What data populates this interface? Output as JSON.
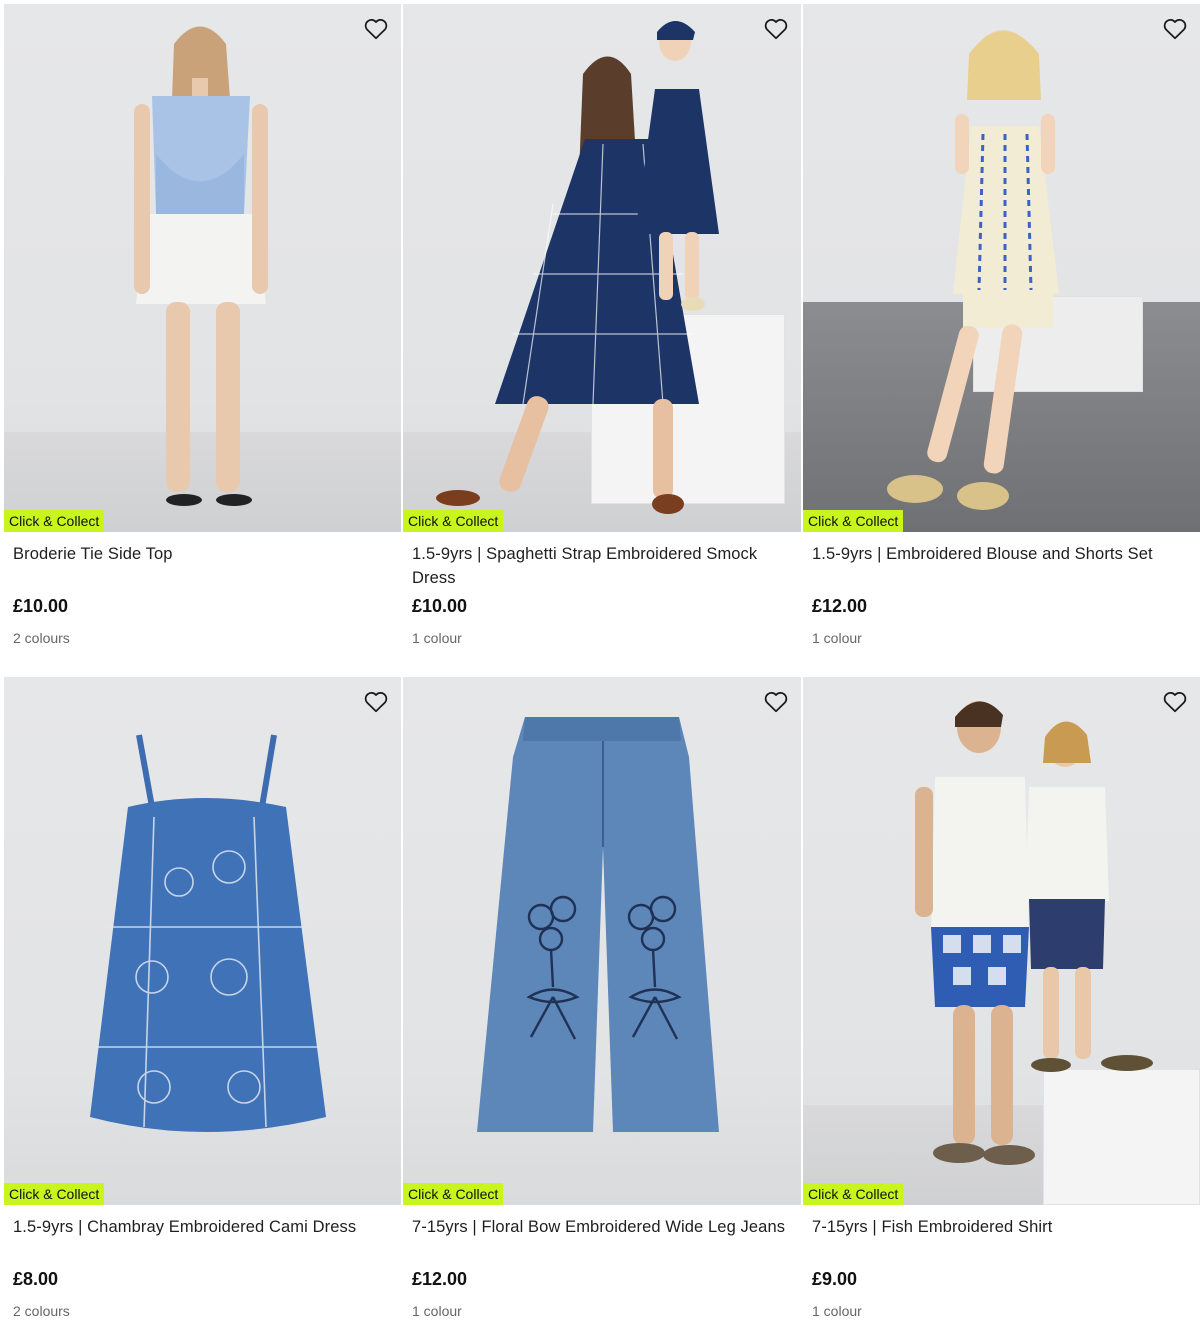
{
  "products": [
    {
      "title": "Broderie Tie Side Top",
      "price": "£10.00",
      "colours": "2 colours",
      "badge": "Click & Collect",
      "image_desc": "woman-blue-top"
    },
    {
      "title": "1.5-9yrs | Spaghetti Strap Embroidered Smock Dress",
      "price": "£10.00",
      "colours": "1 colour",
      "badge": "Click & Collect",
      "image_desc": "mother-daughter-navy-dresses"
    },
    {
      "title": "1.5-9yrs | Embroidered Blouse and Shorts Set",
      "price": "£12.00",
      "colours": "1 colour",
      "badge": "Click & Collect",
      "image_desc": "girl-blouse-shorts-set"
    },
    {
      "title": "1.5-9yrs | Chambray Embroidered Cami Dress",
      "price": "£8.00",
      "colours": "2 colours",
      "badge": "Click & Collect",
      "image_desc": "chambray-cami-dress"
    },
    {
      "title": "7-15yrs | Floral Bow Embroidered Wide Leg Jeans",
      "price": "£12.00",
      "colours": "1 colour",
      "badge": "Click & Collect",
      "image_desc": "wide-leg-jeans"
    },
    {
      "title": "7-15yrs | Fish Embroidered Shirt",
      "price": "£9.00",
      "colours": "1 colour",
      "badge": "Click & Collect",
      "image_desc": "father-son-shirts"
    }
  ],
  "colors": {
    "badge": "#c8f51d",
    "background": "#e4e5e7"
  },
  "icons": {
    "wishlist": "heart-outline-icon"
  }
}
